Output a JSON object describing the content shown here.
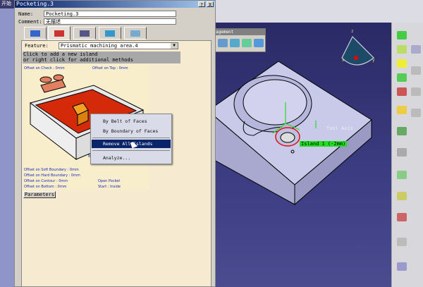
{
  "taskbar": {
    "start_label": "开始"
  },
  "dialog": {
    "title": "Pocketing.3",
    "help_button": "?",
    "close_button": "X",
    "name_label": "Name:",
    "name_value": "Pocketing.3",
    "comment_label": "Comment:",
    "comment_value": "无描述",
    "tabs": [
      {
        "name": "strategy-tab",
        "icon": "strategy-icon"
      },
      {
        "name": "geometry-tab",
        "icon": "geometry-icon",
        "active": true
      },
      {
        "name": "tool-tab",
        "icon": "tool-icon"
      },
      {
        "name": "feeds-speeds-tab",
        "icon": "feeds-speeds-icon"
      },
      {
        "name": "macros-tab",
        "icon": "macros-icon"
      }
    ],
    "feature_label": "Feature:",
    "feature_value": "Prismatic machining area.4",
    "hint_line1": "Click to add a new island",
    "hint_line2": "or right click for additional methods",
    "offsets": {
      "check": "Offset on Check : 0mm",
      "top": "Offset on Top : 0mm",
      "soft": "Offset on Soft Boundary : 0mm",
      "hard": "Offset on Hard Boundary : 0mm",
      "contour": "Offset on Contour : 0mm",
      "bottom": "Offset on Bottom : 0mm",
      "open_pocket": "Open Pocket",
      "start": "Start : Inside",
      "bottom_label": "Bott"
    },
    "parameters_button": "Parameters"
  },
  "context_menu": {
    "items": [
      "By Belt of Faces",
      "By Boundary of Faces",
      "Remove All Islands",
      "Analyze..."
    ],
    "selected": "Remove All Islands"
  },
  "management_toolbar": {
    "title": "agement"
  },
  "viewport": {
    "tool_axis_label": "Tool Axis",
    "island_label": "Island 1 (-2mm)",
    "compass": {
      "x": "x",
      "y": "y",
      "z": "z"
    }
  },
  "colors": {
    "selection": "#0a246a",
    "island_tag": "#22dd22",
    "island_outline": "#e01010",
    "part": "#c8c8e8"
  }
}
